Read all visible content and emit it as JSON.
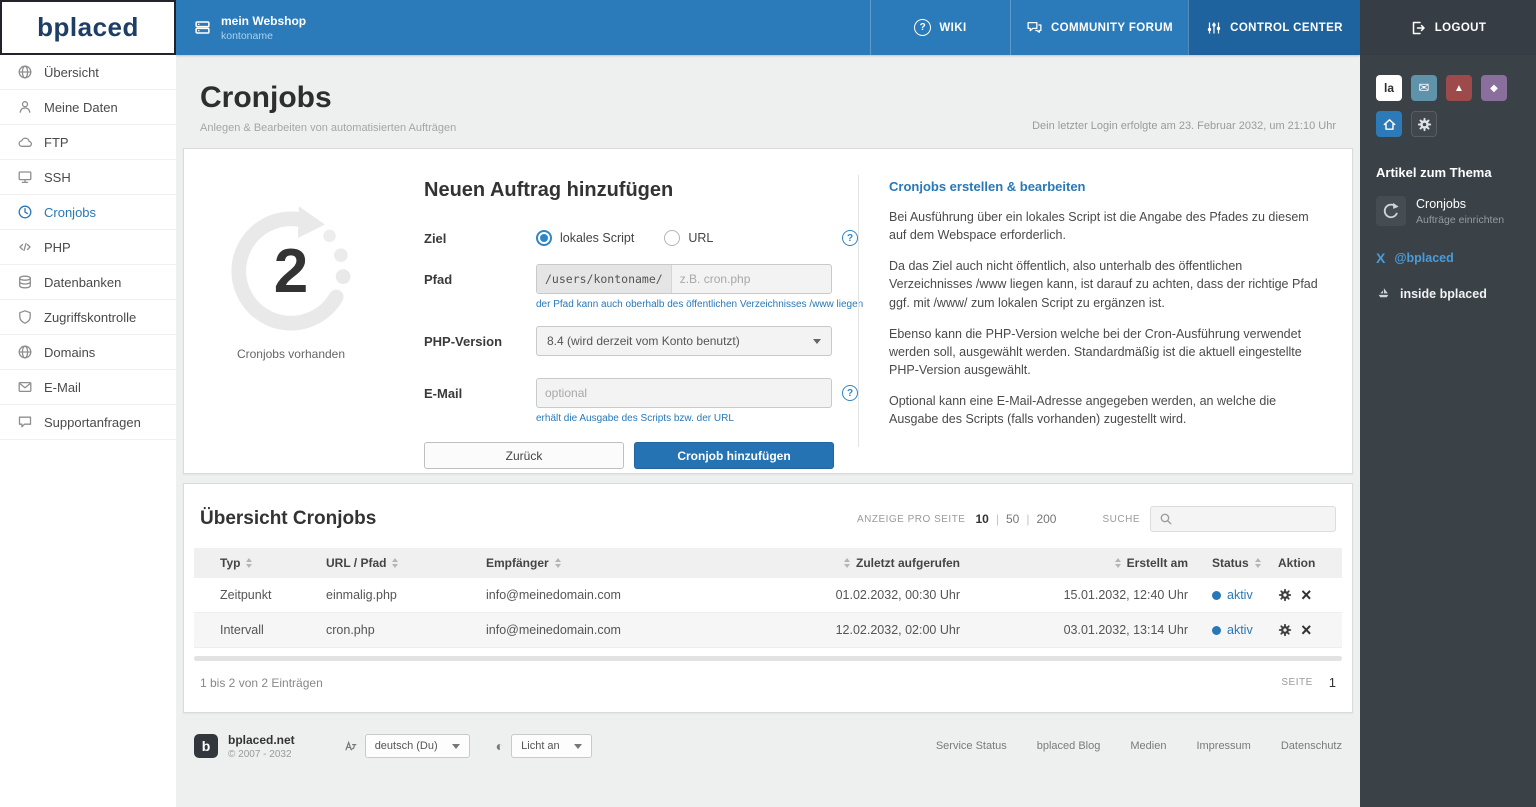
{
  "brand": {
    "logo_text": "bplaced",
    "footer_site": "bplaced.net",
    "footer_copyright": "© 2007 - 2032"
  },
  "topbar": {
    "account_title": "mein Webshop",
    "account_subtitle": "kontoname",
    "nav": [
      {
        "label": "WIKI"
      },
      {
        "label": "COMMUNITY FORUM"
      },
      {
        "label": "CONTROL CENTER"
      }
    ],
    "logout": "LOGOUT"
  },
  "sidebar": {
    "items": [
      {
        "label": "Übersicht"
      },
      {
        "label": "Meine Daten"
      },
      {
        "label": "FTP"
      },
      {
        "label": "SSH"
      },
      {
        "label": "Cronjobs"
      },
      {
        "label": "PHP"
      },
      {
        "label": "Datenbanken"
      },
      {
        "label": "Zugriffskontrolle"
      },
      {
        "label": "Domains"
      },
      {
        "label": "E-Mail"
      },
      {
        "label": "Supportanfragen"
      }
    ]
  },
  "page": {
    "title": "Cronjobs",
    "subtitle": "Anlegen & Bearbeiten von automatisierten Aufträgen",
    "last_login": "Dein letzter Login erfolgte am 23. Februar 2032, um 21:10 Uhr"
  },
  "form": {
    "count": "2",
    "count_label": "Cronjobs vorhanden",
    "heading": "Neuen Auftrag hinzufügen",
    "ziel_label": "Ziel",
    "radio_local": "lokales Script",
    "radio_url": "URL",
    "pfad_label": "Pfad",
    "pfad_prefix": "/users/kontoname/",
    "pfad_placeholder": "z.B. cron.php",
    "pfad_hint": "der Pfad kann auch oberhalb des öffentlichen Verzeichnisses /www liegen",
    "php_label": "PHP-Version",
    "php_value": "8.4 (wird derzeit vom Konto benutzt)",
    "email_label": "E-Mail",
    "email_placeholder": "optional",
    "email_hint": "erhält die Ausgabe des Scripts bzw. der URL",
    "back_button": "Zurück",
    "submit_button": "Cronjob hinzufügen"
  },
  "help": {
    "heading": "Cronjobs erstellen & bearbeiten",
    "paragraphs": [
      "Bei Ausführung über ein lokales Script ist die Angabe des Pfades zu diesem auf dem Webspace erforderlich.",
      "Da das Ziel auch nicht öffentlich, also unterhalb des öffentlichen Verzeichnisses /www liegen kann, ist darauf zu achten, dass der richtige Pfad ggf. mit /www/ zum lokalen Script zu ergänzen ist.",
      "Ebenso kann die PHP-Version welche bei der Cron-Ausführung verwendet werden soll, ausgewählt werden. Standardmäßig ist die aktuell eingestellte PHP-Version ausgewählt.",
      "Optional kann eine E-Mail-Adresse angegeben werden, an welche die Ausgabe des Scripts (falls vorhanden) zugestellt wird."
    ]
  },
  "table": {
    "heading": "Übersicht Cronjobs",
    "per_page_label": "ANZEIGE PRO SEITE",
    "per_page": [
      "10",
      "50",
      "200"
    ],
    "search_label": "SUCHE",
    "columns": [
      "Typ",
      "URL / Pfad",
      "Empfänger",
      "Zuletzt aufgerufen",
      "Erstellt am",
      "Status",
      "Aktion"
    ],
    "rows": [
      {
        "typ": "Zeitpunkt",
        "pfad": "einmalig.php",
        "empfaenger": "info@meinedomain.com",
        "zuletzt": "01.02.2032, 00:30 Uhr",
        "erstellt": "15.01.2032, 12:40 Uhr",
        "status": "aktiv"
      },
      {
        "typ": "Intervall",
        "pfad": "cron.php",
        "empfaenger": "info@meinedomain.com",
        "zuletzt": "12.02.2032, 02:00 Uhr",
        "erstellt": "03.01.2032, 13:14 Uhr",
        "status": "aktiv"
      }
    ],
    "summary": "1 bis 2 von 2 Einträgen",
    "page_label": "SEITE",
    "page_number": "1"
  },
  "footer": {
    "language": "deutsch (Du)",
    "theme": "Licht an",
    "links": [
      "Service Status",
      "bplaced Blog",
      "Medien",
      "Impressum",
      "Datenschutz"
    ]
  },
  "aside": {
    "app_icons": [
      {
        "label": "la"
      }
    ],
    "heading": "Artikel zum Thema",
    "article_title": "Cronjobs",
    "article_subtitle": "Aufträge einrichten",
    "twitter": "@bplaced",
    "inside": "inside bplaced"
  },
  "colors": {
    "topbar_blue": "#2b7ab9",
    "topbar_active": "#1f639e",
    "accent_blue": "#2878b8",
    "dark_sidebar": "#3a4147",
    "status_active": "#2878b8"
  }
}
